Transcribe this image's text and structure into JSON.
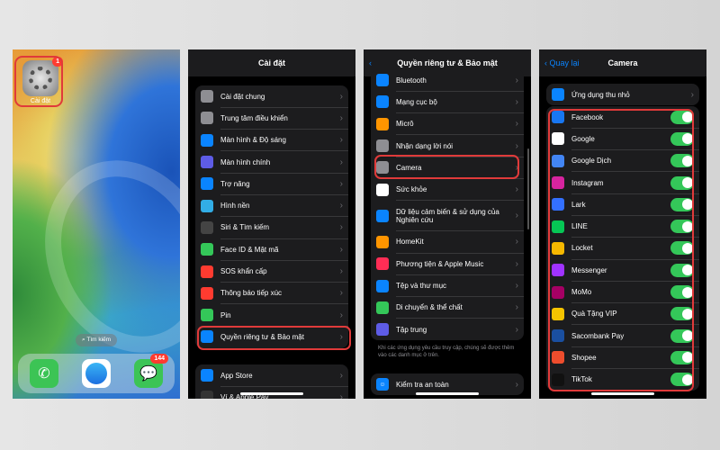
{
  "home": {
    "settings_label": "Cài đặt",
    "settings_badge": "1",
    "search_label": "Tìm kiếm",
    "messages_badge": "144"
  },
  "settings": {
    "title": "Cài đặt",
    "items": [
      {
        "label": "Cài đặt chung",
        "icon": "gear-icon",
        "color": "#8e8e93"
      },
      {
        "label": "Trung tâm điều khiển",
        "icon": "control-center-icon",
        "color": "#8e8e93"
      },
      {
        "label": "Màn hình & Độ sáng",
        "icon": "display-icon",
        "color": "#0a84ff"
      },
      {
        "label": "Màn hình chính",
        "icon": "home-screen-icon",
        "color": "#5e5ce6"
      },
      {
        "label": "Trợ năng",
        "icon": "accessibility-icon",
        "color": "#0a84ff"
      },
      {
        "label": "Hình nền",
        "icon": "wallpaper-icon",
        "color": "#32ade6"
      },
      {
        "label": "Siri & Tìm kiếm",
        "icon": "siri-icon",
        "color": "#444"
      },
      {
        "label": "Face ID & Mật mã",
        "icon": "faceid-icon",
        "color": "#34c759"
      },
      {
        "label": "SOS khẩn cấp",
        "icon": "sos-icon",
        "color": "#ff3b30"
      },
      {
        "label": "Thông báo tiếp xúc",
        "icon": "exposure-icon",
        "color": "#ff3b30"
      },
      {
        "label": "Pin",
        "icon": "battery-icon",
        "color": "#34c759"
      },
      {
        "label": "Quyền riêng tư & Bảo mật",
        "icon": "privacy-hand-icon",
        "color": "#0a84ff"
      }
    ],
    "items2": [
      {
        "label": "App Store",
        "icon": "appstore-icon",
        "color": "#0a84ff"
      },
      {
        "label": "Ví & Apple Pay",
        "icon": "wallet-icon",
        "color": "#333"
      }
    ]
  },
  "privacy": {
    "title": "Quyền riêng tư & Bảo mật",
    "items": [
      {
        "label": "Bluetooth",
        "icon": "bluetooth-icon",
        "color": "#0a84ff"
      },
      {
        "label": "Mạng cục bộ",
        "icon": "network-icon",
        "color": "#0a84ff"
      },
      {
        "label": "Micrô",
        "icon": "microphone-icon",
        "color": "#ff9500"
      },
      {
        "label": "Nhận dạng lời nói",
        "icon": "speech-icon",
        "color": "#8e8e93"
      },
      {
        "label": "Camera",
        "icon": "camera-icon",
        "color": "#8e8e93"
      },
      {
        "label": "Sức khỏe",
        "icon": "health-icon",
        "color": "#fff"
      },
      {
        "label": "Dữ liệu cảm biến & sử dụng của Nghiên cứu",
        "icon": "research-icon",
        "color": "#0a84ff"
      },
      {
        "label": "HomeKit",
        "icon": "homekit-icon",
        "color": "#ff9500"
      },
      {
        "label": "Phương tiện & Apple Music",
        "icon": "music-icon",
        "color": "#ff2d55"
      },
      {
        "label": "Tệp và thư mục",
        "icon": "files-icon",
        "color": "#0a84ff"
      },
      {
        "label": "Di chuyển & thể chất",
        "icon": "fitness-icon",
        "color": "#34c759"
      },
      {
        "label": "Tập trung",
        "icon": "focus-icon",
        "color": "#5e5ce6"
      }
    ],
    "footnote": "Khi các ứng dụng yêu cầu truy cập, chúng sẽ được thêm vào các danh mục ở trên.",
    "safety_check": "Kiểm tra an toàn"
  },
  "camera": {
    "back": "Quay lại",
    "title": "Camera",
    "widgets": "Ứng dụng thu nhỏ",
    "apps": [
      {
        "label": "Facebook",
        "icon": "facebook-icon",
        "color": "#1877f2",
        "on": true
      },
      {
        "label": "Google",
        "icon": "google-icon",
        "color": "#ffffff",
        "on": true
      },
      {
        "label": "Google Dịch",
        "icon": "google-translate-icon",
        "color": "#4285f4",
        "on": true
      },
      {
        "label": "Instagram",
        "icon": "instagram-icon",
        "color": "#d6249f",
        "on": true
      },
      {
        "label": "Lark",
        "icon": "lark-icon",
        "color": "#3370ff",
        "on": true
      },
      {
        "label": "LINE",
        "icon": "line-icon",
        "color": "#06c755",
        "on": true
      },
      {
        "label": "Locket",
        "icon": "locket-icon",
        "color": "#f5b800",
        "on": true
      },
      {
        "label": "Messenger",
        "icon": "messenger-icon",
        "color": "#a033ff",
        "on": true
      },
      {
        "label": "MoMo",
        "icon": "momo-icon",
        "color": "#a50064",
        "on": true
      },
      {
        "label": "Quà Tặng VIP",
        "icon": "gift-vip-icon",
        "color": "#f5c400",
        "on": true
      },
      {
        "label": "Sacombank Pay",
        "icon": "sacombank-icon",
        "color": "#1a4fa0",
        "on": true
      },
      {
        "label": "Shopee",
        "icon": "shopee-icon",
        "color": "#ee4d2d",
        "on": true
      },
      {
        "label": "TikTok",
        "icon": "tiktok-icon",
        "color": "#111111",
        "on": true
      }
    ]
  }
}
